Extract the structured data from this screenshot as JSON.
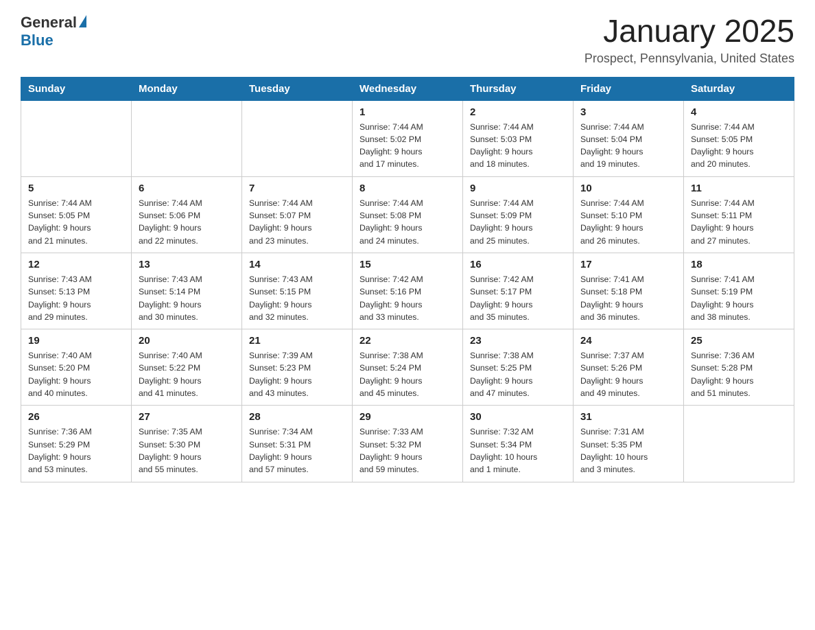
{
  "header": {
    "logo_general": "General",
    "logo_blue": "Blue",
    "month_title": "January 2025",
    "location": "Prospect, Pennsylvania, United States"
  },
  "days_of_week": [
    "Sunday",
    "Monday",
    "Tuesday",
    "Wednesday",
    "Thursday",
    "Friday",
    "Saturday"
  ],
  "weeks": [
    [
      {
        "day": "",
        "info": ""
      },
      {
        "day": "",
        "info": ""
      },
      {
        "day": "",
        "info": ""
      },
      {
        "day": "1",
        "info": "Sunrise: 7:44 AM\nSunset: 5:02 PM\nDaylight: 9 hours\nand 17 minutes."
      },
      {
        "day": "2",
        "info": "Sunrise: 7:44 AM\nSunset: 5:03 PM\nDaylight: 9 hours\nand 18 minutes."
      },
      {
        "day": "3",
        "info": "Sunrise: 7:44 AM\nSunset: 5:04 PM\nDaylight: 9 hours\nand 19 minutes."
      },
      {
        "day": "4",
        "info": "Sunrise: 7:44 AM\nSunset: 5:05 PM\nDaylight: 9 hours\nand 20 minutes."
      }
    ],
    [
      {
        "day": "5",
        "info": "Sunrise: 7:44 AM\nSunset: 5:05 PM\nDaylight: 9 hours\nand 21 minutes."
      },
      {
        "day": "6",
        "info": "Sunrise: 7:44 AM\nSunset: 5:06 PM\nDaylight: 9 hours\nand 22 minutes."
      },
      {
        "day": "7",
        "info": "Sunrise: 7:44 AM\nSunset: 5:07 PM\nDaylight: 9 hours\nand 23 minutes."
      },
      {
        "day": "8",
        "info": "Sunrise: 7:44 AM\nSunset: 5:08 PM\nDaylight: 9 hours\nand 24 minutes."
      },
      {
        "day": "9",
        "info": "Sunrise: 7:44 AM\nSunset: 5:09 PM\nDaylight: 9 hours\nand 25 minutes."
      },
      {
        "day": "10",
        "info": "Sunrise: 7:44 AM\nSunset: 5:10 PM\nDaylight: 9 hours\nand 26 minutes."
      },
      {
        "day": "11",
        "info": "Sunrise: 7:44 AM\nSunset: 5:11 PM\nDaylight: 9 hours\nand 27 minutes."
      }
    ],
    [
      {
        "day": "12",
        "info": "Sunrise: 7:43 AM\nSunset: 5:13 PM\nDaylight: 9 hours\nand 29 minutes."
      },
      {
        "day": "13",
        "info": "Sunrise: 7:43 AM\nSunset: 5:14 PM\nDaylight: 9 hours\nand 30 minutes."
      },
      {
        "day": "14",
        "info": "Sunrise: 7:43 AM\nSunset: 5:15 PM\nDaylight: 9 hours\nand 32 minutes."
      },
      {
        "day": "15",
        "info": "Sunrise: 7:42 AM\nSunset: 5:16 PM\nDaylight: 9 hours\nand 33 minutes."
      },
      {
        "day": "16",
        "info": "Sunrise: 7:42 AM\nSunset: 5:17 PM\nDaylight: 9 hours\nand 35 minutes."
      },
      {
        "day": "17",
        "info": "Sunrise: 7:41 AM\nSunset: 5:18 PM\nDaylight: 9 hours\nand 36 minutes."
      },
      {
        "day": "18",
        "info": "Sunrise: 7:41 AM\nSunset: 5:19 PM\nDaylight: 9 hours\nand 38 minutes."
      }
    ],
    [
      {
        "day": "19",
        "info": "Sunrise: 7:40 AM\nSunset: 5:20 PM\nDaylight: 9 hours\nand 40 minutes."
      },
      {
        "day": "20",
        "info": "Sunrise: 7:40 AM\nSunset: 5:22 PM\nDaylight: 9 hours\nand 41 minutes."
      },
      {
        "day": "21",
        "info": "Sunrise: 7:39 AM\nSunset: 5:23 PM\nDaylight: 9 hours\nand 43 minutes."
      },
      {
        "day": "22",
        "info": "Sunrise: 7:38 AM\nSunset: 5:24 PM\nDaylight: 9 hours\nand 45 minutes."
      },
      {
        "day": "23",
        "info": "Sunrise: 7:38 AM\nSunset: 5:25 PM\nDaylight: 9 hours\nand 47 minutes."
      },
      {
        "day": "24",
        "info": "Sunrise: 7:37 AM\nSunset: 5:26 PM\nDaylight: 9 hours\nand 49 minutes."
      },
      {
        "day": "25",
        "info": "Sunrise: 7:36 AM\nSunset: 5:28 PM\nDaylight: 9 hours\nand 51 minutes."
      }
    ],
    [
      {
        "day": "26",
        "info": "Sunrise: 7:36 AM\nSunset: 5:29 PM\nDaylight: 9 hours\nand 53 minutes."
      },
      {
        "day": "27",
        "info": "Sunrise: 7:35 AM\nSunset: 5:30 PM\nDaylight: 9 hours\nand 55 minutes."
      },
      {
        "day": "28",
        "info": "Sunrise: 7:34 AM\nSunset: 5:31 PM\nDaylight: 9 hours\nand 57 minutes."
      },
      {
        "day": "29",
        "info": "Sunrise: 7:33 AM\nSunset: 5:32 PM\nDaylight: 9 hours\nand 59 minutes."
      },
      {
        "day": "30",
        "info": "Sunrise: 7:32 AM\nSunset: 5:34 PM\nDaylight: 10 hours\nand 1 minute."
      },
      {
        "day": "31",
        "info": "Sunrise: 7:31 AM\nSunset: 5:35 PM\nDaylight: 10 hours\nand 3 minutes."
      },
      {
        "day": "",
        "info": ""
      }
    ]
  ]
}
